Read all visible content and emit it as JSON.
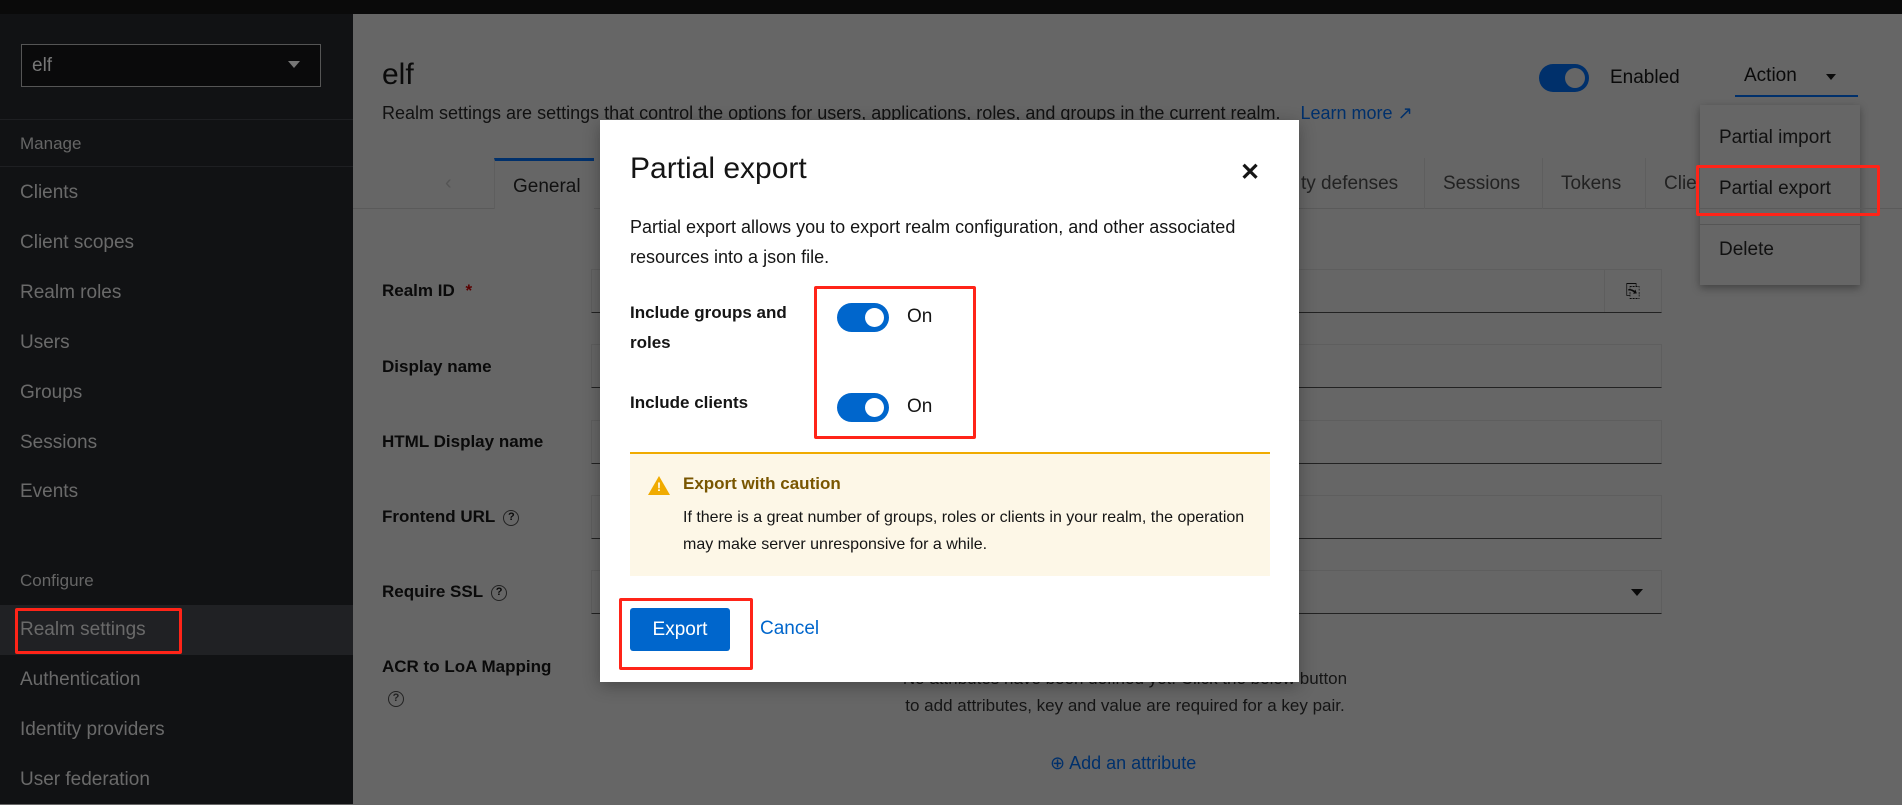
{
  "sidebar": {
    "realm": "elf",
    "manage_label": "Manage",
    "configure_label": "Configure",
    "manage_items": [
      "Clients",
      "Client scopes",
      "Realm roles",
      "Users",
      "Groups",
      "Sessions",
      "Events"
    ],
    "configure_items": [
      "Realm settings",
      "Authentication",
      "Identity providers",
      "User federation"
    ],
    "active_item": "Realm settings"
  },
  "header": {
    "title": "elf",
    "description": "Realm settings are settings that control the options for users, applications, roles, and groups in the current realm.",
    "learn_more": "Learn more",
    "enabled_label": "Enabled",
    "enabled": true,
    "action_label": "Action"
  },
  "action_menu": {
    "items": [
      "Partial import",
      "Partial export",
      "Delete"
    ]
  },
  "tabs": {
    "items": [
      "General",
      "ty defenses",
      "Sessions",
      "Tokens",
      "Clie"
    ],
    "active": "General"
  },
  "form": {
    "labels": [
      "Realm ID",
      "Display name",
      "HTML Display name",
      "Frontend URL",
      "Require SSL",
      "ACR to LoA Mapping"
    ],
    "required_mark": "*",
    "attributes_empty": "No attributes have been defined yet. Click the below button to add attributes, key and value are required for a key pair.",
    "add_attribute": "Add an attribute"
  },
  "modal": {
    "title": "Partial export",
    "description": "Partial export allows you to export realm configuration, and other associated resources into a json file.",
    "include_groups_label": "Include groups and roles",
    "include_groups_value": "On",
    "include_clients_label": "Include clients",
    "include_clients_value": "On",
    "alert_title": "Export with caution",
    "alert_body": "If there is a great number of groups, roles or clients in your realm, the operation may make server unresponsive for a while.",
    "export_label": "Export",
    "cancel_label": "Cancel"
  },
  "colors": {
    "primary": "#0066cc",
    "warning": "#f0ab00",
    "highlight": "#ff2418"
  }
}
